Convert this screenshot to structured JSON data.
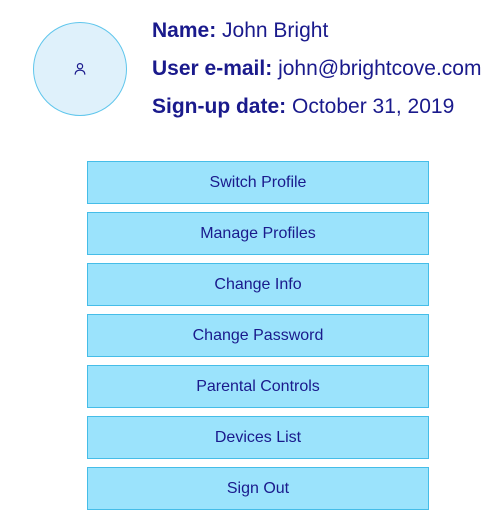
{
  "profile": {
    "avatar_icon": "user-icon",
    "name_label": "Name:",
    "name_value": "John Bright",
    "email_label": "User e-mail:",
    "email_value": "john@brightcove.com",
    "signup_label": "Sign-up date:",
    "signup_value": "October 31, 2019"
  },
  "menu": {
    "items": [
      {
        "label": "Switch Profile"
      },
      {
        "label": "Manage Profiles"
      },
      {
        "label": "Change Info"
      },
      {
        "label": "Change Password"
      },
      {
        "label": "Parental Controls"
      },
      {
        "label": "Devices List"
      },
      {
        "label": "Sign Out"
      }
    ]
  },
  "colors": {
    "text": "#1a1a8c",
    "button_fill": "#9be3fc",
    "button_border": "#45bde8",
    "avatar_fill": "#dff1fb",
    "avatar_border": "#5fc6ec"
  }
}
